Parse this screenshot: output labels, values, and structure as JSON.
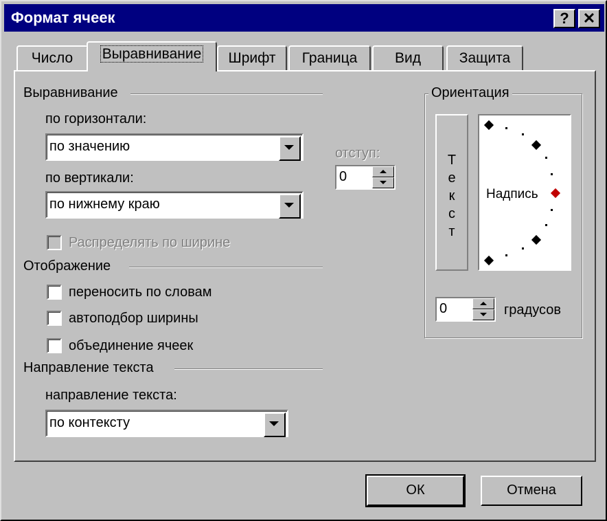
{
  "window": {
    "title": "Формат ячеек",
    "help_label": "?",
    "close_label": "✕"
  },
  "tabs": [
    {
      "label": "Число"
    },
    {
      "label": "Выравнивание"
    },
    {
      "label": "Шрифт"
    },
    {
      "label": "Граница"
    },
    {
      "label": "Вид"
    },
    {
      "label": "Защита"
    }
  ],
  "alignment": {
    "group_label": "Выравнивание",
    "horizontal_label": "по горизонтали:",
    "horizontal_value": "по значению",
    "vertical_label": "по вертикали:",
    "vertical_value": "по нижнему краю",
    "indent_label": "отступ:",
    "indent_value": "0",
    "distribute_label": "Распределять по ширине"
  },
  "display": {
    "group_label": "Отображение",
    "wrap_label": "переносить по словам",
    "autofit_label": "автоподбор ширины",
    "merge_label": "объединение ячеек"
  },
  "text_direction": {
    "group_label": "Направление текста",
    "direction_label": "направление текста:",
    "direction_value": "по контексту"
  },
  "orientation": {
    "group_label": "Ориентация",
    "vertical_letters": [
      "Т",
      "е",
      "к",
      "с",
      "т"
    ],
    "label_text": "Надпись",
    "degrees_value": "0",
    "degrees_label": "градусов",
    "marker_color": "#c00000"
  },
  "footer": {
    "ok_label": "ОК",
    "cancel_label": "Отмена"
  },
  "icons": [
    "help-icon",
    "close-icon",
    "chevron-down-icon",
    "spin-up-icon",
    "spin-down-icon"
  ]
}
